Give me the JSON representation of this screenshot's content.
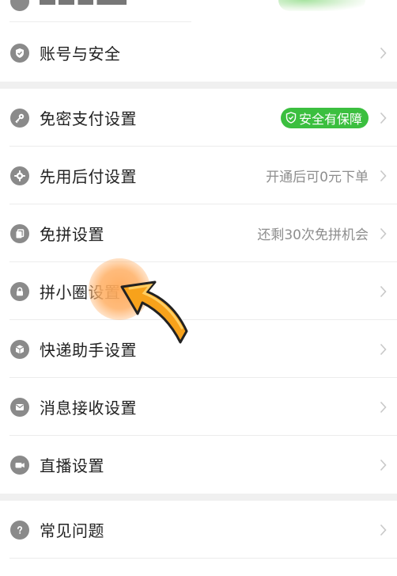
{
  "menu_groups": [
    {
      "items": [
        {
          "label": "账号与安全",
          "icon": "shield-check-icon"
        }
      ]
    },
    {
      "items": [
        {
          "label": "免密支付设置",
          "icon": "key-icon",
          "badge": "安全有保障"
        },
        {
          "label": "先用后付设置",
          "icon": "gear-icon",
          "value": "开通后可0元下单"
        },
        {
          "label": "免拼设置",
          "icon": "copy-icon",
          "value": "还剩30次免拼机会"
        },
        {
          "label": "拼小圈设置",
          "icon": "lock-icon"
        },
        {
          "label": "快递助手设置",
          "icon": "package-icon"
        },
        {
          "label": "消息接收设置",
          "icon": "message-icon"
        },
        {
          "label": "直播设置",
          "icon": "video-camera-icon"
        }
      ]
    },
    {
      "items": [
        {
          "label": "常见问题",
          "icon": "question-icon"
        }
      ]
    }
  ],
  "colors": {
    "badge_bg": "#3bbf3f",
    "icon_gray": "#8a8a8a",
    "page_bg": "#f0f0f0",
    "highlight_orange": "#f5a623"
  }
}
